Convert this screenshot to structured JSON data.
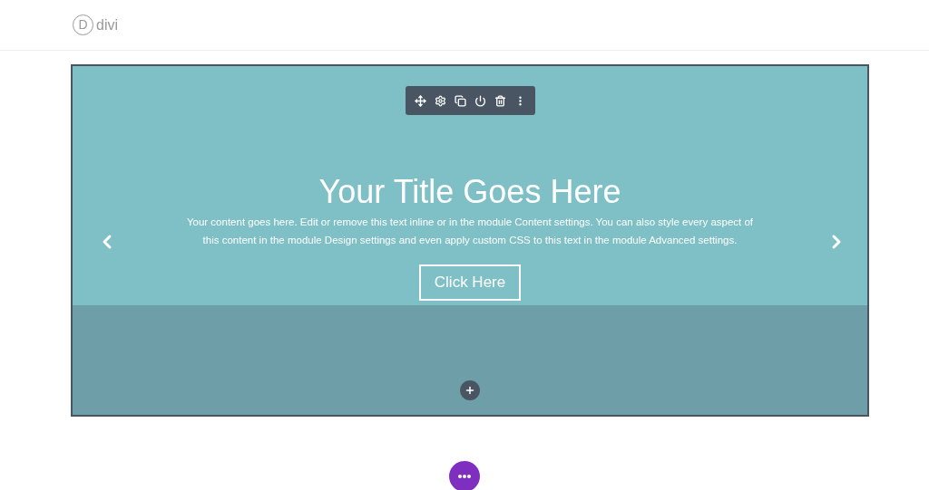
{
  "header": {
    "logo_mark": "D",
    "logo_text": "divi"
  },
  "slider": {
    "title": "Your Title Goes Here",
    "content": "Your content goes here. Edit or remove this text inline or in the module Content settings. You can also style every aspect of this content in the module Design settings and even apply custom CSS to this text in the module Advanced settings.",
    "button": "Click Here"
  }
}
